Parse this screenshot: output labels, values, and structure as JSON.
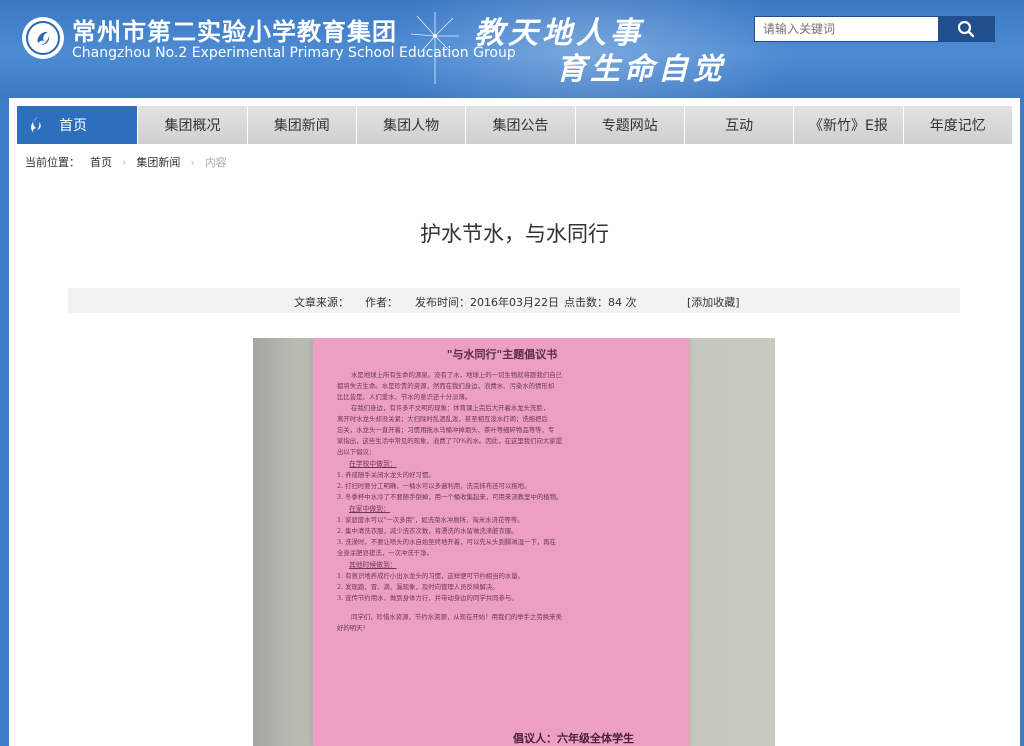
{
  "header": {
    "school_cn": "常州市第二实验小学教育集团",
    "school_en": "Changzhou No.2 Experimental Primary School Education Group",
    "slogan_line1": "教天地人事",
    "slogan_line2": "育生命自觉",
    "search_placeholder": "请输入关键词",
    "logo_icon": "school-logo-icon",
    "search_icon": "search-icon"
  },
  "nav": {
    "items": [
      {
        "label": "首页",
        "active": true
      },
      {
        "label": "集团概况"
      },
      {
        "label": "集团新闻"
      },
      {
        "label": "集团人物"
      },
      {
        "label": "集团公告"
      },
      {
        "label": "专题网站"
      },
      {
        "label": "互动"
      },
      {
        "label": "《新竹》E报"
      },
      {
        "label": "年度记忆"
      }
    ]
  },
  "breadcrumb": {
    "label": "当前位置：",
    "items": [
      "首页",
      "集团新闻",
      "内容"
    ]
  },
  "article": {
    "title": "护水节水，与水同行",
    "source_label": "文章来源：",
    "author_label": "作者：",
    "date_label": "发布时间：2016年03月22日",
    "clicks_label": "点击数：",
    "clicks_value": "84 次",
    "favorite_label": "[添加收藏]"
  },
  "poster": {
    "title": "\"与水同行\"主题倡议书",
    "para1_a": "水是地球上所有生命的源泉。没有了水，地球上的一切生物就将跟我们自己",
    "para1_b": "都将失去生命。水是珍贵的资源，然而在我们身边，浪费水、污染水的情形却",
    "para1_c": "比比皆是。人们爱水、节水的意识还十分淡薄。",
    "para2_a": "在我们身边，有许多不文明的现象：体育课上完后大开着水龙头洗脸，",
    "para2_b": "离开时水龙头却没关紧；大扫除时乱洒乱泼，甚至相互泼水打闹；洗拖把后",
    "para2_c": "忘关，水龙头一直开着；习惯用拖水马桶冲掉烟头、茶叶等细碎物品等等，专",
    "para2_d": "家指出，这些生活中常见的现象，浪费了70%的水。因此，在这里我们向大家提",
    "para2_e": "出以下倡议：",
    "sub1": "在学校中做到：",
    "s1_1": "1.  养成随手关闭水龙头的好习惯。",
    "s1_2": "2.  打扫时要分工明确，一桶水可以多遍利用，洗完抹布还可以拖地。",
    "s1_3": "3.  冬季杯中水冷了不要随手倒掉，用一个桶收集起来，可用来浇教室中的植物。",
    "sub2": "在家中做到：",
    "s2_1": "1.  家庭废水可以\"一次多用\"，如洗菜水冲厕所，淘米水浇花等等。",
    "s2_2": "2.  集中清洗衣服，减少洗衣次数，将漂洗的水留做洗涤脏衣服。",
    "s2_3": "3.  洗澡时，不要让喷头的水自始至终地开着，可以先从头到脚淋湿一下，再在",
    "s2_3b": "    全身涂肥皂搓洗，一次冲洗干净。",
    "sub3": "其他时候做到：",
    "s3_1": "1.  有意识地养成拧小出水龙头的习惯，这样便可节约相当的水量。",
    "s3_2": "2.  发现跑、冒、滴、漏现象，及时向管理人员反映解决。",
    "s3_3": "3.  宣传节约用水，做到身体力行，并带动身边的同学共同参与。",
    "closing_a": "同学们，珍惜水资源，节约水资源，从现在开始！用我们的举手之劳换来美",
    "closing_b": "好的明天！",
    "sign": "倡议人：六年级全体学生"
  },
  "colors": {
    "header_blue": "#3f7cc7",
    "nav_active": "#2d6fbd",
    "search_button": "#1f4f8c",
    "poster_pink": "#ec9fc3"
  }
}
